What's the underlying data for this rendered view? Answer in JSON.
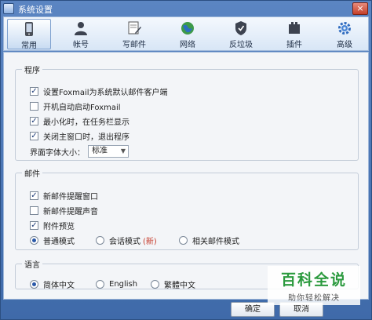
{
  "window": {
    "title": "系统设置",
    "close_glyph": "×"
  },
  "toolbar": {
    "items": [
      {
        "label": "常用",
        "icon": "phone-icon",
        "active": true
      },
      {
        "label": "帐号",
        "icon": "user-icon"
      },
      {
        "label": "写邮件",
        "icon": "write-mail-icon"
      },
      {
        "label": "网络",
        "icon": "globe-icon"
      },
      {
        "label": "反垃圾",
        "icon": "anti-spam-icon"
      },
      {
        "label": "插件",
        "icon": "plugin-icon"
      },
      {
        "label": "高级",
        "icon": "gear-icon"
      }
    ]
  },
  "program": {
    "legend": "程序",
    "set_default": {
      "label": "设置Foxmail为系统默认邮件客户端",
      "checked": true
    },
    "autostart": {
      "label": "开机自动启动Foxmail",
      "checked": false
    },
    "minimize_tray": {
      "label": "最小化时，在任务栏显示",
      "checked": true
    },
    "close_exit": {
      "label": "关闭主窗口时，退出程序",
      "checked": true
    },
    "font_size": {
      "label": "界面字体大小：",
      "value": "标准"
    }
  },
  "mail": {
    "legend": "邮件",
    "new_mail_window": {
      "label": "新邮件提醒窗口",
      "checked": true
    },
    "new_mail_sound": {
      "label": "新邮件提醒声音",
      "checked": false
    },
    "attachment_preview": {
      "label": "附件预览",
      "checked": true
    },
    "view_mode": {
      "normal": "普通模式",
      "conversation": "会话模式",
      "new_tag": "(新)",
      "related": "相关邮件模式",
      "selected": "normal"
    }
  },
  "language": {
    "legend": "语言",
    "simplified": "简体中文",
    "english": "English",
    "traditional": "繁體中文",
    "selected": "simplified"
  },
  "footer": {
    "ok": "确定",
    "cancel": "取消"
  },
  "watermark": {
    "line1": "百科全说",
    "line2": "助你轻松解决"
  },
  "colors": {
    "accent": "#3f6aa9",
    "check": "#1d3c78",
    "new_tag": "#c63a2a",
    "watermark": "#2b9a3e"
  }
}
